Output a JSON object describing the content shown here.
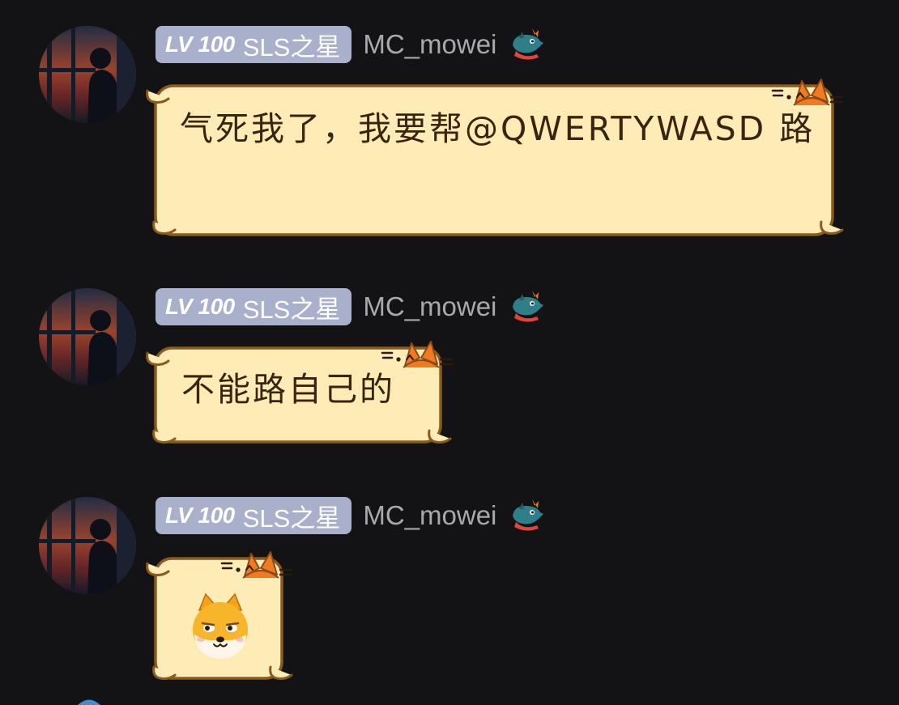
{
  "messages": [
    {
      "badge": {
        "level": "LV 100",
        "title": "SLS之星"
      },
      "username": "MC_mowei",
      "text": "气死我了，我要帮@QWERTYWASD 路"
    },
    {
      "badge": {
        "level": "LV 100",
        "title": "SLS之星"
      },
      "username": "MC_mowei",
      "text": "不能路自己的"
    },
    {
      "badge": {
        "level": "LV 100",
        "title": "SLS之星"
      },
      "username": "MC_mowei",
      "sticker": "shiba-dog-sticker"
    }
  ],
  "colors": {
    "background": "#131315",
    "badge": "#a9b0cb",
    "username": "#a8a8ae",
    "bubble_fill": "#fdecb6",
    "bubble_stroke": "#8a5a1e",
    "cat_orange": "#f07a22"
  },
  "icons": [
    "avatar-silhouette",
    "dragon-icon",
    "cat-ears-decoration",
    "shiba-dog-sticker"
  ]
}
